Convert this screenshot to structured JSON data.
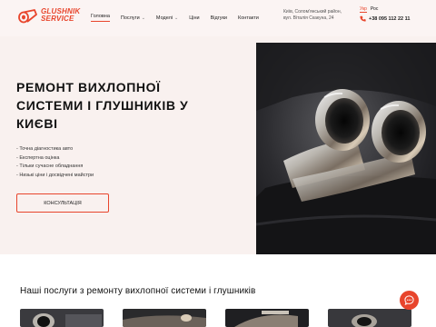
{
  "brand": {
    "line1": "GLUSHNIK",
    "line2": "SERVICE",
    "accent": "#e8452c"
  },
  "nav": [
    {
      "label": "Головна"
    },
    {
      "label": "Послуги"
    },
    {
      "label": "Моделі"
    },
    {
      "label": "Ціни"
    },
    {
      "label": "Відгуки"
    },
    {
      "label": "Контакти"
    }
  ],
  "address": {
    "line1": "Київ, Солом'янський район,",
    "line2": "вул. Віталія Скакуна, 24"
  },
  "languages": [
    "Укр",
    "Рос"
  ],
  "phone": "+38 095 112 22 11",
  "hero": {
    "title": "РЕМОНТ ВИХЛОПНОЇ СИСТЕМИ І ГЛУШНИКІВ У КИЄВІ",
    "features": [
      "- Точна діагностика авто",
      "- Експертна оцінка",
      "- Тільки сучасне обладнання",
      "- Низькі ціни і досвідчені майстри"
    ],
    "cta": "КОНСУЛЬТАЦІЯ"
  },
  "services": {
    "heading": "Наші послуги з ремонту вихлопної системи і глушників"
  },
  "icons": {
    "logo": "muffler-logo-icon",
    "phone": "phone-icon",
    "chat": "chat-icon",
    "caret": "chevron-down-icon"
  }
}
